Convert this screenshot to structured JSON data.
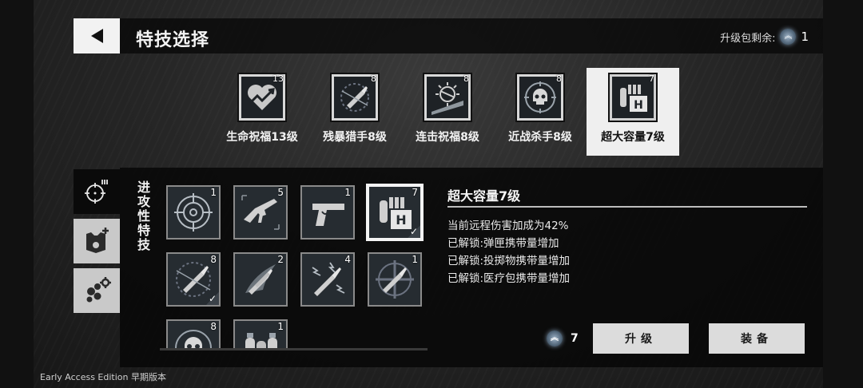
{
  "header": {
    "title": "特技选择",
    "points_label": "升级包剩余:",
    "points_value": "1"
  },
  "top_perks": [
    {
      "name": "生命祝福13级",
      "level": "13",
      "icon": "heart-arrow-icon",
      "selected": false
    },
    {
      "name": "残暴猎手8级",
      "level": "8",
      "icon": "bullet-slash-icon",
      "selected": false
    },
    {
      "name": "连击祝福8级",
      "level": "8",
      "icon": "combo-bar-icon",
      "selected": false
    },
    {
      "name": "近战杀手8级",
      "level": "8",
      "icon": "skull-crosshair-icon",
      "selected": false
    },
    {
      "name": "超大容量7级",
      "level": "7",
      "icon": "ammo-box-icon",
      "selected": true
    }
  ],
  "side_tabs": [
    {
      "icon": "crosshair-ammo-icon",
      "active": true
    },
    {
      "icon": "armor-plus-icon",
      "active": false
    },
    {
      "icon": "cells-gear-icon",
      "active": false
    }
  ],
  "category_label": "进攻性特技",
  "grid_perks": [
    {
      "icon": "crosshair-icon",
      "level": "1",
      "equipped": false,
      "selected": false
    },
    {
      "icon": "rifle-icon",
      "level": "5",
      "equipped": false,
      "selected": false
    },
    {
      "icon": "pistol-icon",
      "level": "1",
      "equipped": false,
      "selected": false
    },
    {
      "icon": "ammo-box-icon",
      "level": "7",
      "equipped": true,
      "selected": true
    },
    {
      "icon": "bullet-slash-icon",
      "level": "8",
      "equipped": true,
      "selected": false
    },
    {
      "icon": "bullets-fire-icon",
      "level": "2",
      "equipped": false,
      "selected": false
    },
    {
      "icon": "bullet-spark-icon",
      "level": "4",
      "equipped": false,
      "selected": false
    },
    {
      "icon": "bullet-target-icon",
      "level": "1",
      "equipped": false,
      "selected": false
    },
    {
      "icon": "skull-crosshair-icon",
      "level": "8",
      "equipped": false,
      "selected": false
    },
    {
      "icon": "grenade-pack-icon",
      "level": "1",
      "equipped": false,
      "selected": false
    }
  ],
  "detail": {
    "title": "超大容量7级",
    "lines": [
      "当前远程伤害加成为42%",
      "已解锁:弹匣携带量增加",
      "已解锁:投掷物携带量增加",
      "已解锁:医疗包携带量增加"
    ]
  },
  "upgrade_cost": "7",
  "buttons": {
    "upgrade": "升级",
    "equip": "装备"
  },
  "footer": "Early Access Edition 早期版本"
}
